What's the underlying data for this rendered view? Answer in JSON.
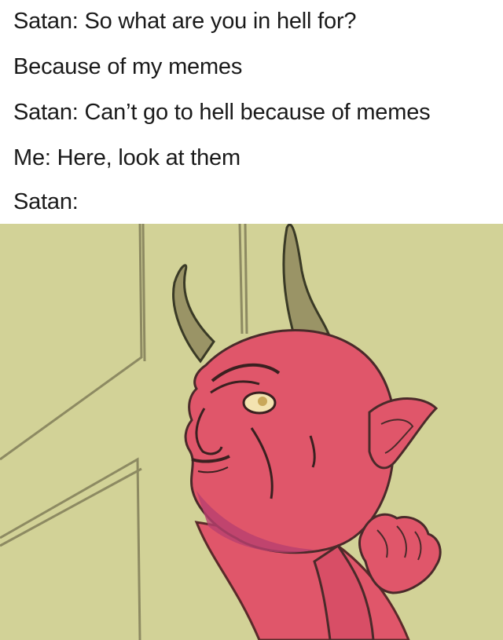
{
  "meme": {
    "lines": [
      "Satan: So what are you in hell for?",
      "Because of my memes",
      "Satan: Can’t go to hell because of memes",
      "Me: Here, look at them",
      "Satan:"
    ],
    "image": {
      "subject": "satan-illustration",
      "colors": {
        "wall": "#cfcf94",
        "skin": "#e0566a",
        "skin_shadow": "#b8406f",
        "horn": "#8f8a5a",
        "outline": "#3a2a2a"
      }
    }
  }
}
